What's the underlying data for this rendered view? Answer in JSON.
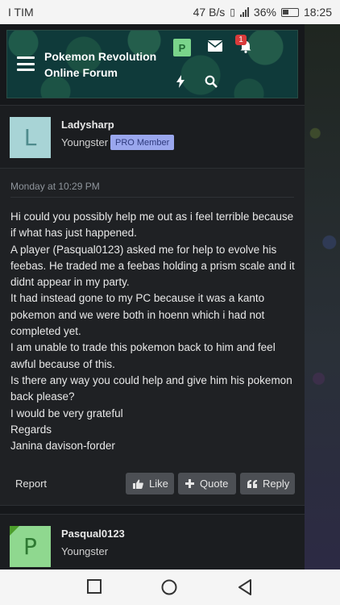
{
  "status_bar": {
    "carrier": "I TIM",
    "speed": "47 B/s",
    "battery": "36%",
    "time": "18:25"
  },
  "header": {
    "forum_title_line1": "Pokemon Revolution",
    "forum_title_line2": "Online Forum",
    "profile_badge": "P",
    "notification_count": "1"
  },
  "post1": {
    "username": "Ladysharp",
    "user_title": "Youngster",
    "badge": "PRO Member",
    "avatar_letter": "L",
    "date": "Monday at 10:29 PM",
    "body": [
      "Hi could you possibly help me out as i feel terrible because if what has just happened.",
      "A player (Pasqual0123) asked me for help to evolve his feebas. He traded me a feebas holding a prism scale and it didnt appear in my party.",
      "It had instead gone to my PC because it was a kanto pokemon and we were both in hoenn which i had not completed yet.",
      "I am unable to trade this pokemon back to him and feel awful because of this.",
      "Is there any way you could help and give him his pokemon back please?",
      "I would be very grateful",
      "Regards",
      "Janina davison-forder"
    ],
    "report": "Report",
    "like": "Like",
    "quote": "Quote",
    "reply": "Reply"
  },
  "post2": {
    "username": "Pasqual0123",
    "user_title": "Youngster",
    "avatar_letter": "P"
  },
  "colors": {
    "accent_badge": "#9aa7ee",
    "button": "#4c4f54",
    "notification": "#d93b3b"
  }
}
